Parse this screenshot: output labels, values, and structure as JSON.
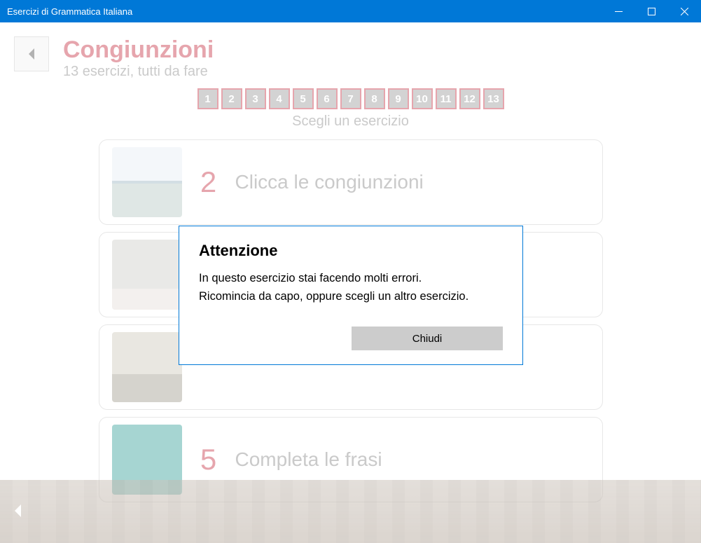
{
  "window": {
    "title": "Esercizi di Grammatica Italiana"
  },
  "header": {
    "title": "Congiunzioni",
    "subtitle": "13 esercizi, tutti da fare"
  },
  "picker": {
    "items": [
      "1",
      "2",
      "3",
      "4",
      "5",
      "6",
      "7",
      "8",
      "9",
      "10",
      "11",
      "12",
      "13"
    ],
    "label": "Scegli un esercizio"
  },
  "cards": [
    {
      "num": "2",
      "title": "Clicca le congiunzioni",
      "thumb": "river"
    },
    {
      "num": "",
      "title": "",
      "thumb": "palace"
    },
    {
      "num": "",
      "title": "",
      "thumb": "church"
    },
    {
      "num": "5",
      "title": "Completa le frasi",
      "thumb": "statue"
    }
  ],
  "modal": {
    "heading": "Attenzione",
    "line1": "In questo esercizio stai facendo molti errori.",
    "line2": "Ricomincia da capo, oppure scegli un altro esercizio.",
    "close": "Chiudi"
  }
}
